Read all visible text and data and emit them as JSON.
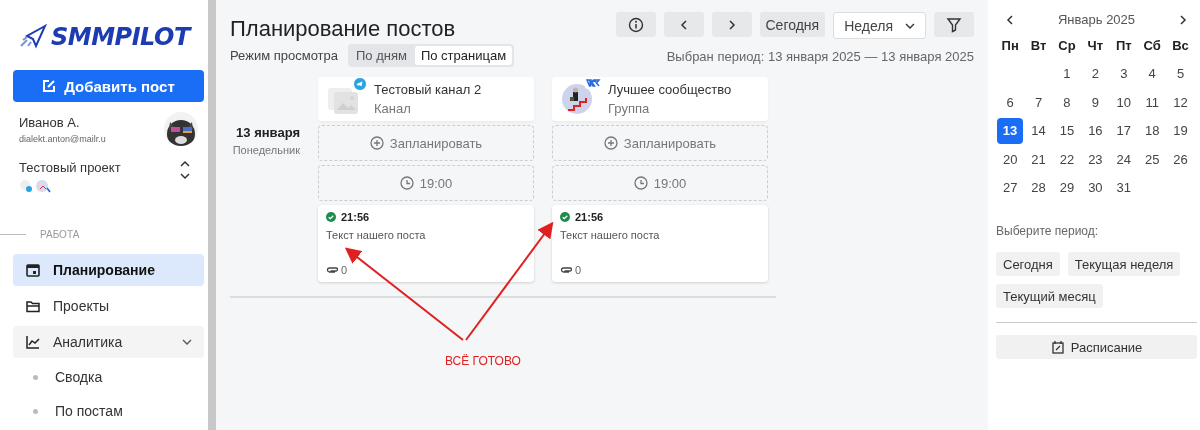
{
  "sidebar": {
    "logo": "SMMPILOT",
    "add_button": "Добавить пост",
    "user": {
      "name": "Иванов А.",
      "email": "dialekt.anton@mailr.u"
    },
    "project": {
      "name": "Тестовый проект"
    },
    "section_label": "РАБОТА",
    "nav": [
      {
        "label": "Планирование",
        "selected": true
      },
      {
        "label": "Проекты",
        "selected": false
      },
      {
        "label": "Аналитика",
        "selected": false,
        "expanded": true,
        "children": [
          {
            "label": "Сводка",
            "selected": false
          },
          {
            "label": "По постам",
            "selected": false
          }
        ]
      }
    ]
  },
  "main": {
    "title": "Планирование постов",
    "view_mode": {
      "label": "Режим просмотра",
      "options": [
        {
          "label": "По дням",
          "selected": false
        },
        {
          "label": "По страницам",
          "selected": true
        }
      ]
    },
    "toolbar": {
      "today": "Сегодня",
      "range": "Неделя"
    },
    "period": "Выбран период: 13 января 2025 — 13 января 2025",
    "date": {
      "day": "13 января",
      "weekday": "Понедельник"
    },
    "channels": [
      {
        "name": "Тестовый канал 2",
        "type": "Канал",
        "badge": {
          "kind": "telegram"
        },
        "avatar": {
          "kind": "placeholder"
        },
        "plan_label": "Запланировать",
        "slot_time": "19:00",
        "posts": [
          {
            "published": true,
            "time": "21:56",
            "text": "Текст нашего поста",
            "attachments": "0"
          }
        ]
      },
      {
        "name": "Лучшее сообщество",
        "type": "Группа",
        "badge": {
          "kind": "vk"
        },
        "avatar": {
          "kind": "picture"
        },
        "plan_label": "Запланировать",
        "slot_time": "19:00",
        "posts": [
          {
            "published": true,
            "time": "21:56",
            "text": "Текст нашего поста",
            "attachments": "0"
          }
        ]
      }
    ],
    "annotation": "ВСЁ ГОТОВО"
  },
  "calendar": {
    "month": "Январь 2025",
    "weekdays": [
      "Пн",
      "Вт",
      "Ср",
      "Чт",
      "Пт",
      "Сб",
      "Вс"
    ],
    "weeks": [
      {
        "kind": "end",
        "days": [
          {
            "d": "1",
            "selected": false
          },
          {
            "d": "2",
            "selected": false
          },
          {
            "d": "3",
            "selected": false
          },
          {
            "d": "4",
            "selected": false
          },
          {
            "d": "5",
            "selected": false
          }
        ]
      },
      {
        "kind": "full",
        "days": [
          {
            "d": "6",
            "selected": false
          },
          {
            "d": "7",
            "selected": false
          },
          {
            "d": "8",
            "selected": false
          },
          {
            "d": "9",
            "selected": false
          },
          {
            "d": "10",
            "selected": false
          },
          {
            "d": "11",
            "selected": false
          },
          {
            "d": "12",
            "selected": false
          }
        ]
      },
      {
        "kind": "full",
        "days": [
          {
            "d": "13",
            "selected": true
          },
          {
            "d": "14",
            "selected": false
          },
          {
            "d": "15",
            "selected": false
          },
          {
            "d": "16",
            "selected": false
          },
          {
            "d": "17",
            "selected": false
          },
          {
            "d": "18",
            "selected": false
          },
          {
            "d": "19",
            "selected": false
          }
        ]
      },
      {
        "kind": "full",
        "days": [
          {
            "d": "20",
            "selected": false
          },
          {
            "d": "21",
            "selected": false
          },
          {
            "d": "22",
            "selected": false
          },
          {
            "d": "23",
            "selected": false
          },
          {
            "d": "24",
            "selected": false
          },
          {
            "d": "25",
            "selected": false
          },
          {
            "d": "26",
            "selected": false
          }
        ]
      },
      {
        "kind": "start",
        "days": [
          {
            "d": "27",
            "selected": false
          },
          {
            "d": "28",
            "selected": false
          },
          {
            "d": "29",
            "selected": false
          },
          {
            "d": "30",
            "selected": false
          },
          {
            "d": "31",
            "selected": false
          }
        ]
      }
    ],
    "period_label": "Выберите период:",
    "period_buttons": [
      "Сегодня",
      "Текущая неделя",
      "Текущий месяц"
    ],
    "schedule_button": "Расписание"
  }
}
